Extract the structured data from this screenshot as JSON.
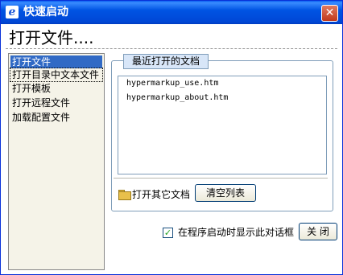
{
  "window": {
    "title": "快速启动",
    "app_icon": "e",
    "close_glyph": "✕"
  },
  "heading": "打开文件....",
  "sidebar": {
    "items": [
      {
        "label": "打开文件",
        "selected": true
      },
      {
        "label": "打开目录中文本文件",
        "focused": true
      },
      {
        "label": "打开模板"
      },
      {
        "label": "打开远程文件"
      },
      {
        "label": "加载配置文件"
      }
    ]
  },
  "recent": {
    "legend": "最近打开的文档",
    "files": [
      "hypermarkup_use.htm",
      "hypermarkup_about.htm"
    ],
    "open_other_label": "打开其它文档",
    "clear_label": "清空列表"
  },
  "footer": {
    "show_on_startup_label": "在程序启动时显示此对话框",
    "show_on_startup_checked": true,
    "check_glyph": "✓",
    "close_label": "关  闭"
  },
  "colors": {
    "titlebar": "#0054e3",
    "selection": "#316ac5",
    "window_bg": "#ece9d8",
    "panel_border": "#7f9db9"
  }
}
